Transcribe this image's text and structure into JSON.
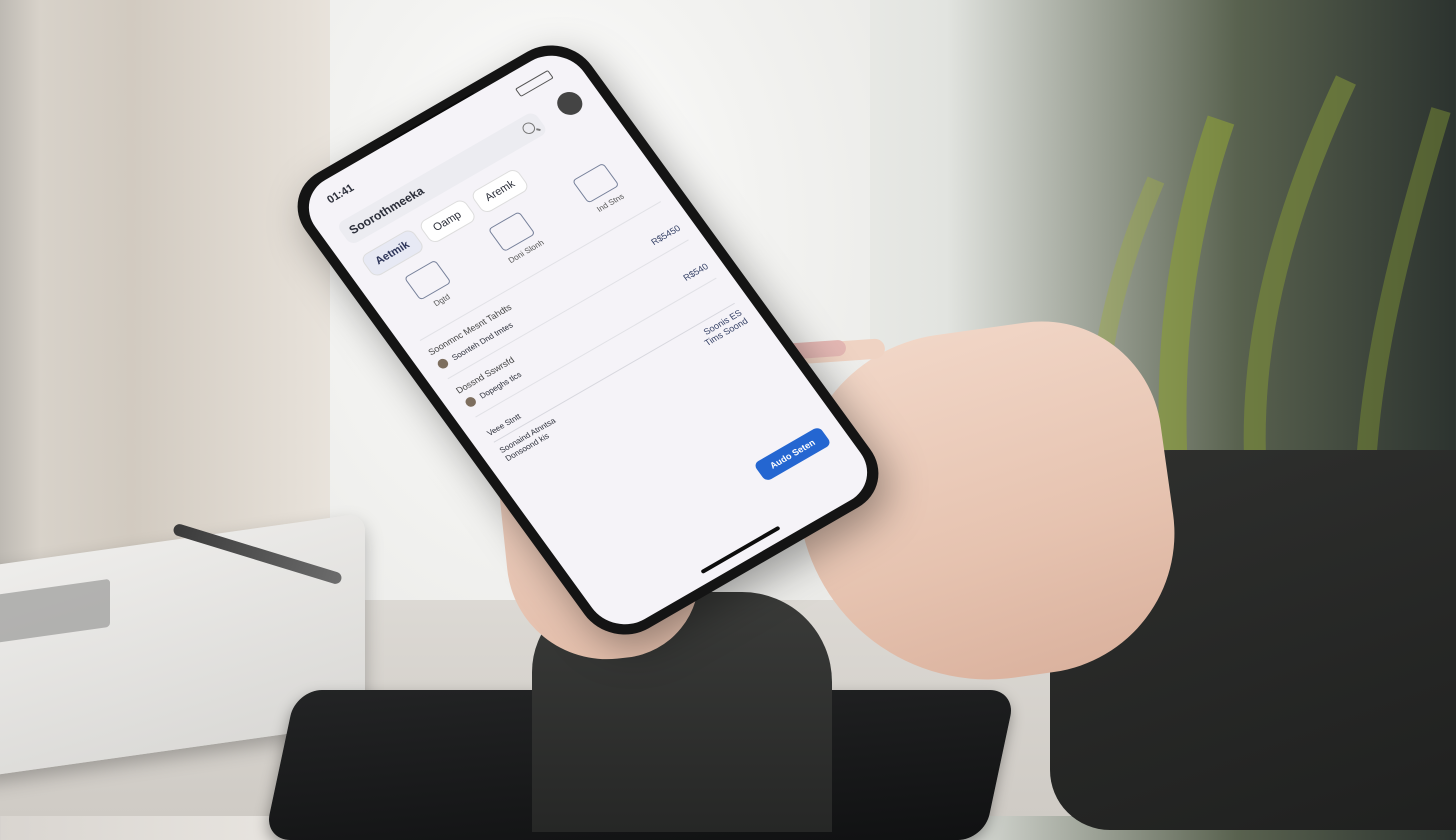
{
  "phone": {
    "status_time": "01:41",
    "app_title": "Soorothmeeka",
    "tabs": [
      "Aetmik",
      "Oamp",
      "Aremk"
    ],
    "cards": [
      {
        "label": "Dgtd"
      },
      {
        "label": "Doni Slonh"
      },
      {
        "label": "Ind Stns"
      }
    ],
    "rows": [
      {
        "head": "Soonmnc Mesnt Tahdts",
        "sub": "Soonteh Dnd tmtes",
        "amount": "R$5450"
      },
      {
        "head": "Dossnd Sswrsfd",
        "sub": "Dopeghs tlcs",
        "amount": "R$540"
      }
    ],
    "summary_title": "Veee Stntt",
    "summary_lines": [
      "Soonaind Atnntsa",
      "Donsoond kis"
    ],
    "summary_values": [
      "Soonis ES",
      "Tims Soond"
    ],
    "cta_label": "Audo Seten"
  }
}
